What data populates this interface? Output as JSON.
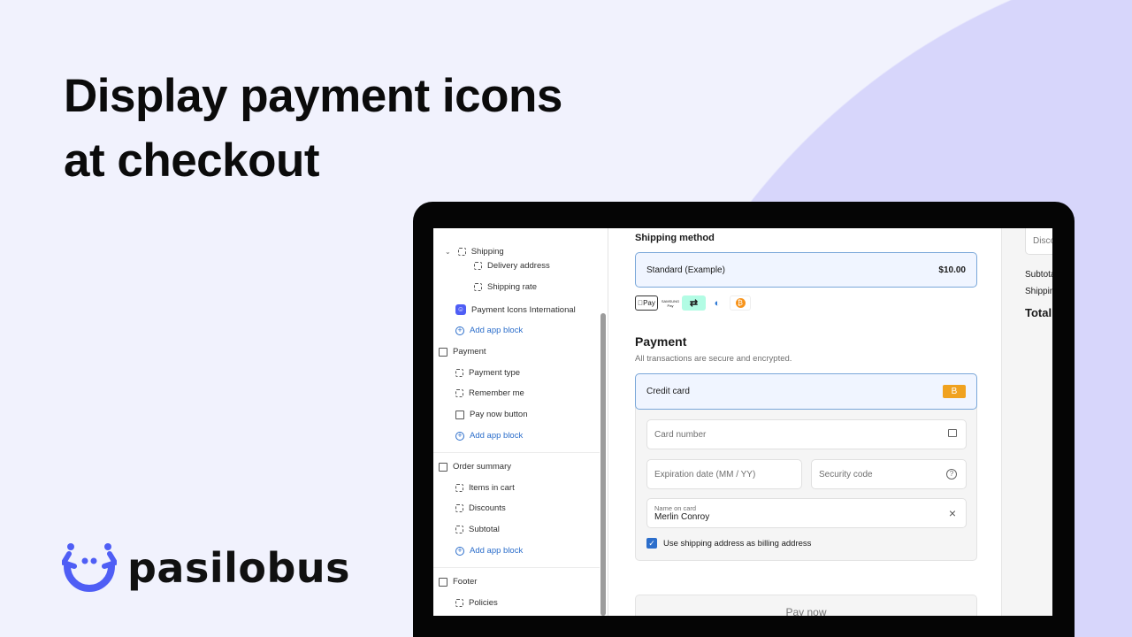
{
  "headline": {
    "line1": "Display payment icons",
    "line2": "at checkout"
  },
  "brand": {
    "name": "pasilobus",
    "color": "#4f5ef5"
  },
  "sidebar": {
    "items": [
      {
        "label": "Shipping",
        "icon": "dashed-square-icon"
      },
      {
        "label": "Delivery address",
        "icon": "dashed-square-icon"
      },
      {
        "label": "Shipping rate",
        "icon": "dashed-square-icon"
      },
      {
        "label": "Payment Icons International",
        "icon": "app-icon"
      },
      {
        "label": "Add app block",
        "icon": "plus-circle-icon"
      },
      {
        "label": "Payment",
        "icon": "cash-icon"
      },
      {
        "label": "Payment type",
        "icon": "dashed-square-icon"
      },
      {
        "label": "Remember me",
        "icon": "dashed-square-icon"
      },
      {
        "label": "Pay now button",
        "icon": "cursor-button-icon"
      },
      {
        "label": "Add app block",
        "icon": "plus-circle-icon"
      },
      {
        "label": "Order summary",
        "icon": "receipt-icon"
      },
      {
        "label": "Items in cart",
        "icon": "dashed-square-icon"
      },
      {
        "label": "Discounts",
        "icon": "dashed-square-icon"
      },
      {
        "label": "Subtotal",
        "icon": "dashed-square-icon"
      },
      {
        "label": "Add app block",
        "icon": "plus-circle-icon"
      },
      {
        "label": "Footer",
        "icon": "footer-icon"
      },
      {
        "label": "Policies",
        "icon": "dashed-square-icon"
      }
    ]
  },
  "checkout": {
    "shipping_heading": "Shipping method",
    "shipping_option": "Standard (Example)",
    "shipping_price": "$10.00",
    "payment_icons": [
      {
        "label": "Pay",
        "name": "apple-pay"
      },
      {
        "label": "SAMSUNG Pay",
        "name": "samsung-pay"
      },
      {
        "label": "",
        "name": "afterpay"
      },
      {
        "label": "",
        "name": "diners-club"
      },
      {
        "label": "₿",
        "name": "bitcoin"
      }
    ],
    "payment_heading": "Payment",
    "payment_sub": "All transactions are secure and encrypted.",
    "credit_card": "Credit card",
    "card_badge": "B",
    "card_badge_color": "#f0a21f",
    "card_number": "Card number",
    "expiration": "Expiration date (MM / YY)",
    "security": "Security code",
    "name_label": "Name on card",
    "name_value": "Merlin Conroy",
    "billing_checkbox": "Use shipping address as billing address",
    "billing_checked": true,
    "pay_now": "Pay now",
    "accent": "#2c6ecb"
  },
  "summary": {
    "discount": "Disco",
    "subtotal": "Subtota",
    "shipping": "Shippin",
    "total": "Total"
  }
}
